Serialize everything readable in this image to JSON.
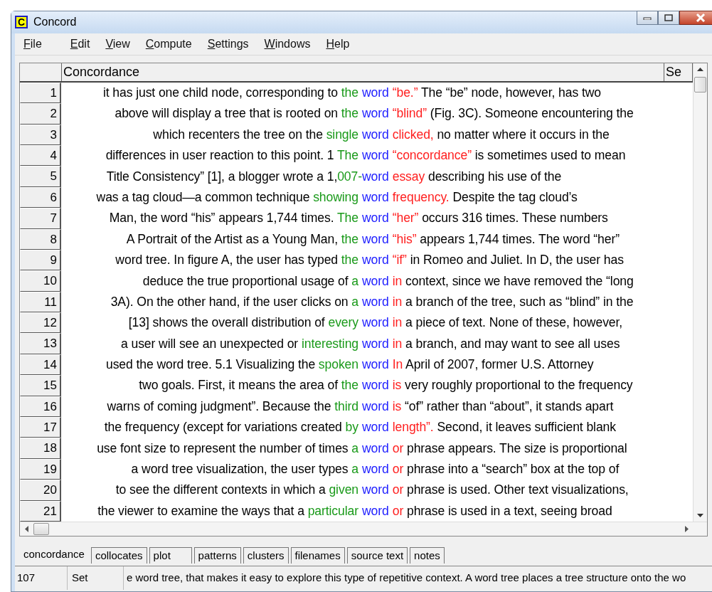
{
  "window": {
    "title": "Concord",
    "app_icon": "C"
  },
  "menu": [
    "File",
    "Edit",
    "View",
    "Compute",
    "Settings",
    "Windows",
    "Help"
  ],
  "table": {
    "columns": [
      "Concordance",
      "Se"
    ],
    "rows": [
      {
        "number": "1",
        "pre": "it has just one child node, corresponding to",
        "left": "the",
        "node": "word",
        "right": "“be.”",
        "post": "The “be” node, however, has two",
        "joined": false
      },
      {
        "number": "2",
        "pre": "above will display a tree that is rooted on",
        "left": "the",
        "node": "word",
        "right": "“blind”",
        "post": "(Fig. 3C). Someone encountering the",
        "joined": false
      },
      {
        "number": "3",
        "pre": "which recenters the tree on the",
        "left": "single",
        "node": "word",
        "right": "clicked,",
        "post": "no matter where it occurs in the",
        "joined": false
      },
      {
        "number": "4",
        "pre": "differences in user reaction to this point. 1",
        "left": "The",
        "node": "word",
        "right": "“concordance”",
        "post": "is sometimes used to mean",
        "joined": false
      },
      {
        "number": "5",
        "pre": "Title Consistency” [1], a blogger wrote a 1,",
        "left": "007-",
        "node": "word",
        "right": "essay",
        "post": "describing his use of the",
        "joined": true
      },
      {
        "number": "6",
        "pre": "was a tag cloud—a common technique",
        "left": "showing",
        "node": "word",
        "right": "frequency.",
        "post": "Despite the tag cloud’s",
        "joined": false
      },
      {
        "number": "7",
        "pre": "Man, the word “his” appears 1,744 times.",
        "left": "The",
        "node": "word",
        "right": "“her”",
        "post": "occurs 316 times. These numbers",
        "joined": false
      },
      {
        "number": "8",
        "pre": "A Portrait of the Artist as a Young Man,",
        "left": "the",
        "node": "word",
        "right": "“his”",
        "post": "appears 1,744 times. The word “her”",
        "joined": false
      },
      {
        "number": "9",
        "pre": "word tree. In figure A, the user has typed",
        "left": "the",
        "node": "word",
        "right": "“if”",
        "post": "in Romeo and Juliet. In D, the user has",
        "joined": false
      },
      {
        "number": "10",
        "pre": "deduce the true proportional usage of",
        "left": "a",
        "node": "word",
        "right": "in",
        "post": "context, since we have removed the “long",
        "joined": false
      },
      {
        "number": "11",
        "pre": "3A). On the other hand, if the user clicks on",
        "left": "a",
        "node": "word",
        "right": "in",
        "post": "a branch of the tree, such as “blind” in the",
        "joined": false
      },
      {
        "number": "12",
        "pre": "[13] shows the overall distribution of",
        "left": "every",
        "node": "word",
        "right": "in",
        "post": "a piece of text. None of these, however,",
        "joined": false
      },
      {
        "number": "13",
        "pre": "a user will see an unexpected or",
        "left": "interesting",
        "node": "word",
        "right": "in",
        "post": "a branch, and may want to see all uses",
        "joined": false
      },
      {
        "number": "14",
        "pre": "used the word tree. 5.1 Visualizing the",
        "left": "spoken",
        "node": "word",
        "right": "In",
        "post": "April of 2007, former U.S. Attorney",
        "joined": false
      },
      {
        "number": "15",
        "pre": "two goals. First, it means the area of",
        "left": "the",
        "node": "word",
        "right": "is",
        "post": "very roughly proportional to the frequency",
        "joined": false
      },
      {
        "number": "16",
        "pre": "warns of coming judgment”. Because the",
        "left": "third",
        "node": "word",
        "right": "is",
        "post": "“of” rather than “about”, it stands apart",
        "joined": false
      },
      {
        "number": "17",
        "pre": "the frequency (except for variations created",
        "left": "by",
        "node": "word",
        "right": "length”.",
        "post": "Second, it leaves sufficient blank",
        "joined": false
      },
      {
        "number": "18",
        "pre": "use font size to represent the number of times",
        "left": "a",
        "node": "word",
        "right": "or",
        "post": "phrase appears. The size is proportional",
        "joined": false
      },
      {
        "number": "19",
        "pre": "a word tree visualization, the user types",
        "left": "a",
        "node": "word",
        "right": "or",
        "post": "phrase into a “search” box at the top of",
        "joined": false
      },
      {
        "number": "20",
        "pre": "to see the different contexts in which a",
        "left": "given",
        "node": "word",
        "right": "or",
        "post": "phrase is used. Other text visualizations,",
        "joined": false
      },
      {
        "number": "21",
        "pre": "the viewer to examine the ways that a",
        "left": "particular",
        "node": "word",
        "right": "or",
        "post": "phrase is used in a text, seeing broad",
        "joined": false
      }
    ]
  },
  "tabs": [
    {
      "label": "concordance",
      "selected": true
    },
    {
      "label": "collocates",
      "selected": false
    },
    {
      "label": "plot",
      "selected": false
    },
    {
      "label": "patterns",
      "selected": false
    },
    {
      "label": "clusters",
      "selected": false
    },
    {
      "label": "filenames",
      "selected": false
    },
    {
      "label": "source text",
      "selected": false
    },
    {
      "label": "notes",
      "selected": false
    }
  ],
  "status_bar": {
    "count": "107",
    "column": "Set",
    "text": "e word tree, that makes it easy to explore this type of repetitive context. A word tree places a tree structure onto the wo"
  }
}
